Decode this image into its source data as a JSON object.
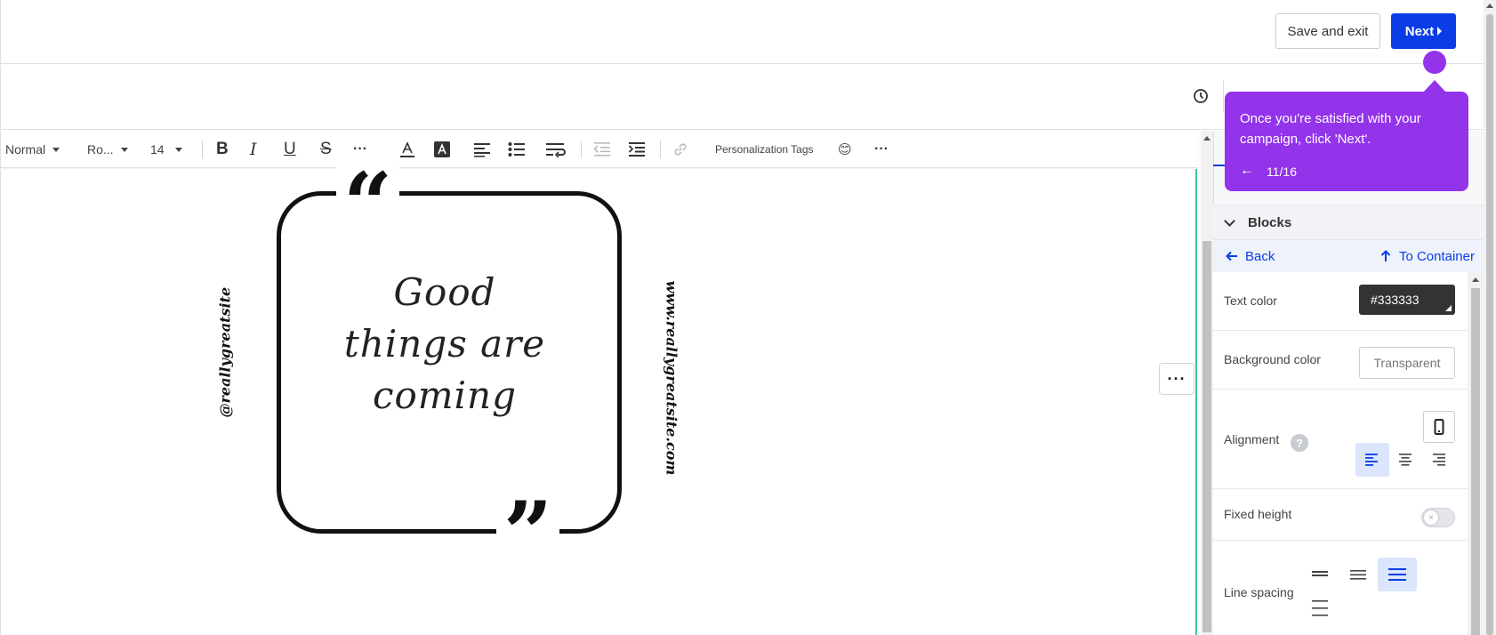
{
  "header": {
    "save_exit_label": "Save and exit",
    "next_label": "Next"
  },
  "toolbar": {
    "paragraph_style": "Normal",
    "font_family": "Ro...",
    "font_size": "14",
    "personalization_label": "Personalization Tags",
    "emoji": "😊"
  },
  "content": {
    "quote_line1": "Good",
    "quote_line2": "things are",
    "quote_line3": "coming",
    "handle": "@reallygreatsite",
    "website": "www.reallygreatsite.com"
  },
  "panel": {
    "section_title": "Blocks",
    "back_label": "Back",
    "container_label": "To Container",
    "text_color_label": "Text color",
    "text_color_value": "#333333",
    "bg_color_label": "Background color",
    "bg_color_placeholder": "Transparent",
    "alignment_label": "Alignment",
    "alignment_selected": "left",
    "fixed_height_label": "Fixed height",
    "fixed_height_on": false,
    "line_spacing_label": "Line spacing",
    "line_spacing_selected": 3
  },
  "tour": {
    "message": "Once you're satisfied with your campaign, click 'Next'.",
    "back_arrow": "←",
    "step": "11/16"
  },
  "colors": {
    "primary": "#0a3de6",
    "tour": "#9333ea",
    "canvas_accent": "#3ec79a"
  }
}
